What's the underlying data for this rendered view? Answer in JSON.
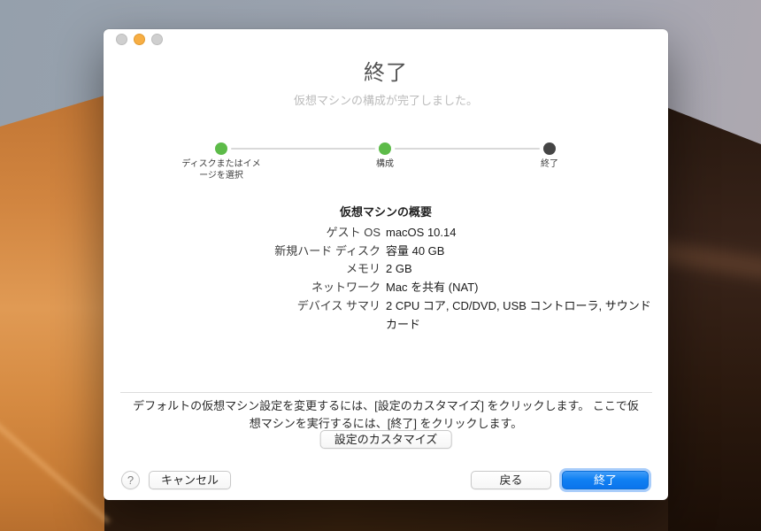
{
  "window": {
    "title": "終了",
    "subtitle": "仮想マシンの構成が完了しました。"
  },
  "stepper": {
    "steps": [
      {
        "label": "ディスクまたはイメージを選択",
        "lines": [
          "ディスクまたはイメ",
          "ージを選択"
        ],
        "state": "complete"
      },
      {
        "label": "構成",
        "lines": [
          "構成"
        ],
        "state": "complete"
      },
      {
        "label": "終了",
        "lines": [
          "終了"
        ],
        "state": "current"
      }
    ]
  },
  "summary": {
    "heading": "仮想マシンの概要",
    "rows": [
      {
        "label": "ゲスト OS",
        "value": "macOS 10.14"
      },
      {
        "label": "新規ハード ディスク",
        "value": "容量 40 GB"
      },
      {
        "label": "メモリ",
        "value": "2 GB"
      },
      {
        "label": "ネットワーク",
        "value": "Mac を共有 (NAT)"
      },
      {
        "label": "デバイス サマリ",
        "value": "2 CPU コア, CD/DVD, USB コントローラ, サウンドカード"
      }
    ]
  },
  "note": {
    "text": "デフォルトの仮想マシン設定を変更するには、[設定のカスタマイズ] をクリックします。 ここで仮想マシンを実行するには、[終了] をクリックします。",
    "lines": [
      "デフォルトの仮想マシン設定を変更するには、[設定のカスタマイズ] をクリックします。 ここで仮",
      "想マシンを実行するには、[終了] をクリックします。"
    ],
    "customize_button_label": "設定のカスタマイズ"
  },
  "footer": {
    "help_label": "?",
    "cancel_label": "キャンセル",
    "back_label": "戻る",
    "finish_label": "終了"
  },
  "colors": {
    "accent_blue": "#1181f3",
    "step_complete_green": "#5dbb49",
    "step_current_dark": "#454545",
    "connector_gray": "#d9d9d9",
    "traffic_minimize_yellow": "#f7ae44",
    "traffic_disabled_gray": "#cfcfcf"
  }
}
